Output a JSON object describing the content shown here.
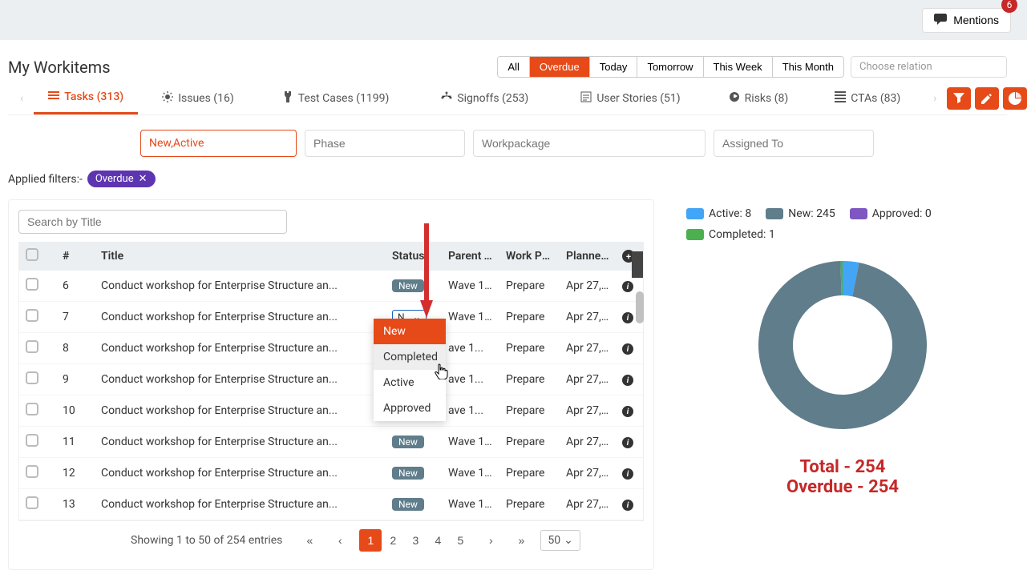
{
  "topbar": {
    "mentions_label": "Mentions",
    "badge": "6"
  },
  "page_title": "My Workitems",
  "time_filters": [
    "All",
    "Overdue",
    "Today",
    "Tomorrow",
    "This Week",
    "This Month"
  ],
  "time_filter_active": 1,
  "relation_placeholder": "Choose relation",
  "tabs": [
    {
      "label": "Tasks (313)"
    },
    {
      "label": "Issues (16)"
    },
    {
      "label": "Test Cases (1199)"
    },
    {
      "label": "Signoffs (253)"
    },
    {
      "label": "User Stories (51)"
    },
    {
      "label": "Risks (8)"
    },
    {
      "label": "CTAs (83)"
    }
  ],
  "tab_active": 0,
  "filter_inputs": {
    "status": "New,Active",
    "phase_placeholder": "Phase",
    "wp_placeholder": "Workpackage",
    "assigned_placeholder": "Assigned To"
  },
  "applied_filters": {
    "label": "Applied filters:-",
    "chips": [
      "Overdue"
    ]
  },
  "search_placeholder": "Search by Title",
  "columns": [
    "#",
    "Title",
    "Status",
    "Parent Task",
    "Work Pack",
    "Planned To"
  ],
  "rows": [
    {
      "num": "6",
      "title": "Conduct workshop for Enterprise Structure an...",
      "status": "New",
      "kind": "pill",
      "parent": "Wave 1...",
      "wp": "Prepare",
      "date": "Apr 27,..."
    },
    {
      "num": "7",
      "title": "Conduct workshop for Enterprise Structure an...",
      "status": "N..",
      "kind": "select",
      "parent": "Wave 1...",
      "wp": "Prepare",
      "date": "Apr 27,..."
    },
    {
      "num": "8",
      "title": "Conduct workshop for Enterprise Structure an...",
      "status": "",
      "kind": "dropdown-row",
      "parent": "ave 1...",
      "wp": "Prepare",
      "date": "Apr 27,..."
    },
    {
      "num": "9",
      "title": "Conduct workshop for Enterprise Structure an...",
      "status": "",
      "kind": "dropdown-row",
      "parent": "ave 1...",
      "wp": "Prepare",
      "date": "Apr 27,..."
    },
    {
      "num": "10",
      "title": "Conduct workshop for Enterprise Structure an...",
      "status": "",
      "kind": "dropdown-row",
      "parent": "ave 1...",
      "wp": "Prepare",
      "date": "Apr 27,..."
    },
    {
      "num": "11",
      "title": "Conduct workshop for Enterprise Structure an...",
      "status": "New",
      "kind": "pill",
      "parent": "Wave 1...",
      "wp": "Prepare",
      "date": "Apr 27,..."
    },
    {
      "num": "12",
      "title": "Conduct workshop for Enterprise Structure an...",
      "status": "New",
      "kind": "pill",
      "parent": "Wave 1...",
      "wp": "Prepare",
      "date": "Apr 27,..."
    },
    {
      "num": "13",
      "title": "Conduct workshop for Enterprise Structure an...",
      "status": "New",
      "kind": "pill",
      "parent": "Wave 1...",
      "wp": "Prepare",
      "date": "Apr 27,..."
    }
  ],
  "status_options": [
    "New",
    "Completed",
    "Active",
    "Approved"
  ],
  "pagination": {
    "info": "Showing 1 to 50 of 254 entries",
    "pages": [
      "1",
      "2",
      "3",
      "4",
      "5"
    ],
    "active": 0,
    "page_size": "50"
  },
  "chart_data": {
    "type": "pie",
    "title": "",
    "series": [
      {
        "name": "Active",
        "value": 8,
        "color": "#42a5f5"
      },
      {
        "name": "New",
        "value": 245,
        "color": "#607d8b"
      },
      {
        "name": "Approved",
        "value": 0,
        "color": "#7e57c2"
      },
      {
        "name": "Completed",
        "value": 1,
        "color": "#4caf50"
      }
    ],
    "totals": [
      {
        "label": "Total",
        "value": 254
      },
      {
        "label": "Overdue",
        "value": 254
      }
    ]
  },
  "legend": {
    "active": "Active: 8",
    "new": "New: 245",
    "approved": "Approved: 0",
    "completed": "Completed: 1"
  },
  "totals_text": {
    "total": "Total - 254",
    "overdue": "Overdue - 254"
  }
}
